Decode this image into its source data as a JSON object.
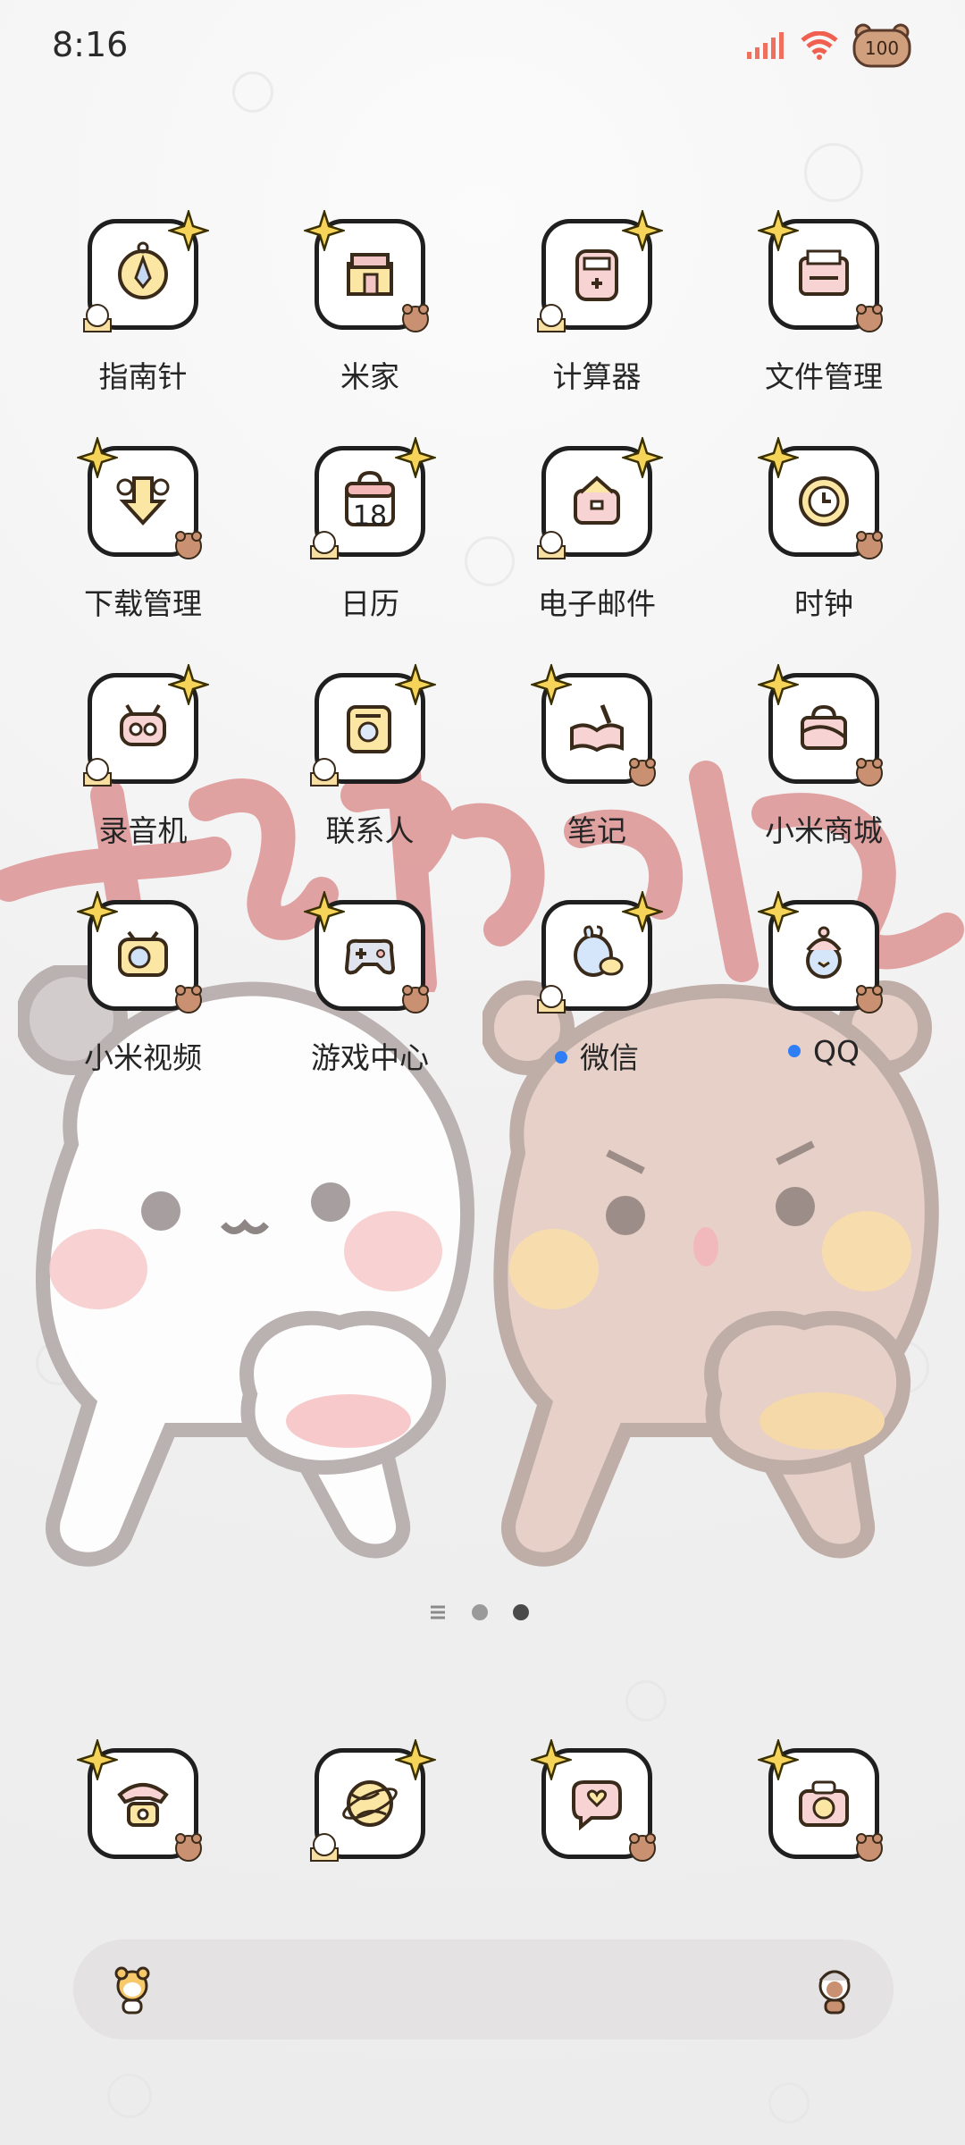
{
  "status_bar": {
    "time": "8:16",
    "battery_level": "100",
    "icons": [
      "signal-icon",
      "wifi-icon",
      "battery-bear-icon"
    ]
  },
  "apps": [
    {
      "label": "指南针",
      "icon": "compass-icon"
    },
    {
      "label": "米家",
      "icon": "mijia-house-icon"
    },
    {
      "label": "计算器",
      "icon": "calculator-icon"
    },
    {
      "label": "文件管理",
      "icon": "file-manager-icon"
    },
    {
      "label": "下载管理",
      "icon": "download-icon"
    },
    {
      "label": "日历",
      "icon": "calendar-icon",
      "calendar_day": "18"
    },
    {
      "label": "电子邮件",
      "icon": "email-icon"
    },
    {
      "label": "时钟",
      "icon": "clock-icon"
    },
    {
      "label": "录音机",
      "icon": "recorder-icon"
    },
    {
      "label": "联系人",
      "icon": "contacts-icon"
    },
    {
      "label": "笔记",
      "icon": "notes-icon"
    },
    {
      "label": "小米商城",
      "icon": "mi-store-icon"
    },
    {
      "label": "小米视频",
      "icon": "mi-video-icon"
    },
    {
      "label": "游戏中心",
      "icon": "game-center-icon"
    },
    {
      "label": "微信",
      "icon": "wechat-icon",
      "notification_dot": true
    },
    {
      "label": "QQ",
      "icon": "qq-icon",
      "notification_dot": true
    }
  ],
  "dock": [
    {
      "icon": "phone-icon"
    },
    {
      "icon": "browser-icon"
    },
    {
      "icon": "messages-icon"
    },
    {
      "icon": "camera-icon"
    }
  ],
  "page_indicator": {
    "pages": 3,
    "current": 3,
    "first_is_menu": true
  },
  "search_bar": {
    "left_icon": "tiger-avatar-icon",
    "right_icon": "bear-avatar-icon"
  },
  "colors": {
    "accent_dot": "#2f7ef6",
    "icon_border": "#1f1f1f",
    "star": "#f6d45a",
    "brush_text": "#d98686"
  }
}
